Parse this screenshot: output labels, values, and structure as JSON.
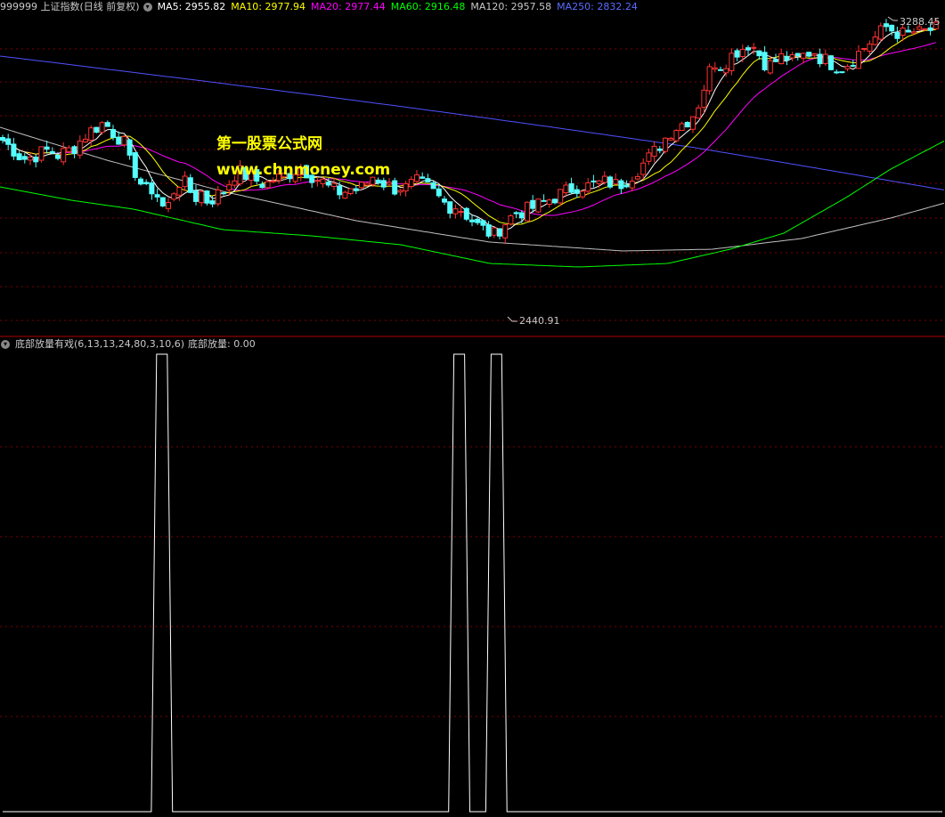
{
  "main_header": {
    "symbol": "999999 上证指数(日线 前复权)",
    "ma5": "MA5: 2955.82",
    "ma10": "MA10: 2977.94",
    "ma20": "MA20: 2977.44",
    "ma60": "MA60: 2916.48",
    "ma120": "MA120: 2957.58",
    "ma250": "MA250: 2832.24"
  },
  "indicator_header": {
    "name": "底部放量有戏(6,13,13,24,80,3,10,6)",
    "value": "底部放量: 0.00"
  },
  "watermark": {
    "line1": "第一股票公式网",
    "line2": "www.chnmoney.com"
  },
  "price_labels": {
    "high": "3288.45",
    "low": "2440.91"
  },
  "colors": {
    "up": "#ff3232",
    "down": "#54ffff",
    "ma5": "#ffffff",
    "ma10": "#ffff00",
    "ma20": "#ff00ff",
    "ma60": "#00ff00",
    "ma120": "#c0c0c0",
    "ma250": "#5050ff",
    "grid": "#7f0000",
    "signal": "#ffffff"
  },
  "chart_data": {
    "type": "line",
    "indicator_signal": [
      0,
      0,
      0,
      0,
      0,
      0,
      0,
      0,
      0,
      0,
      0,
      0,
      0,
      0,
      0,
      0,
      0,
      0,
      0,
      0,
      0,
      0,
      0,
      0,
      0,
      0,
      0,
      0,
      0,
      1,
      1,
      1,
      0,
      0,
      0,
      0,
      0,
      0,
      0,
      0,
      0,
      0,
      0,
      0,
      0,
      0,
      0,
      0,
      0,
      0,
      0,
      0,
      0,
      0,
      0,
      0,
      0,
      0,
      0,
      0,
      0,
      0,
      0,
      0,
      0,
      0,
      0,
      0,
      0,
      0,
      0,
      0,
      0,
      0,
      0,
      0,
      0,
      0,
      0,
      0,
      0,
      0,
      0,
      0,
      0,
      1,
      1,
      1,
      0,
      0,
      0,
      0,
      1,
      1,
      1,
      0,
      0,
      0,
      0,
      0,
      0,
      0,
      0,
      0,
      0,
      0,
      0,
      0,
      0,
      0,
      0,
      0,
      0,
      0,
      0,
      0,
      0,
      0,
      0,
      0,
      0,
      0,
      0,
      0,
      0,
      0,
      0,
      0,
      0,
      0,
      0,
      0,
      0,
      0,
      0,
      0,
      0,
      0,
      0,
      0,
      0,
      0,
      0,
      0,
      0,
      0,
      0,
      0,
      0,
      0,
      0,
      0,
      0,
      0,
      0,
      0,
      0,
      0,
      0,
      0,
      0,
      0,
      0,
      0,
      0,
      0,
      0,
      0,
      0,
      0,
      0,
      0,
      0,
      0,
      0,
      0,
      0,
      0
    ]
  }
}
